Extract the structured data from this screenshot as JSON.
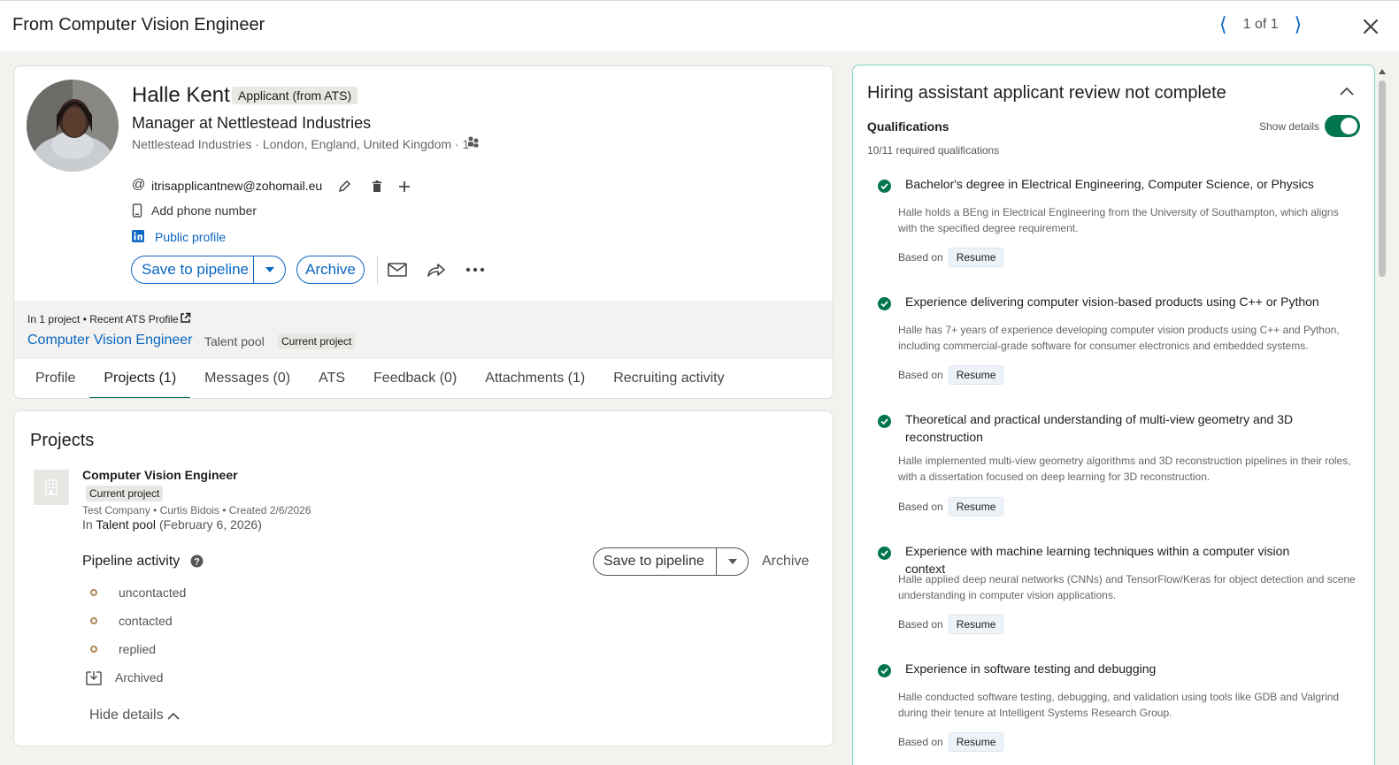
{
  "header": {
    "title": "From Computer Vision Engineer",
    "pager_text": "1 of 1"
  },
  "profile": {
    "name": "Halle Kent",
    "badge": "Applicant (from ATS)",
    "headline": "Manager at Nettlestead Industries",
    "meta": "Nettlestead Industries · London, England, United Kingdom · 1",
    "email": "itrisapplicantnew@zohomail.eu",
    "phone_label": "Add phone number",
    "public_profile_label": "Public profile",
    "save_label": "Save to pipeline",
    "archive_label": "Archive",
    "ats_line": "In 1 project • Recent ATS Profile",
    "project_link": "Computer Vision Engineer",
    "project_stage": "Talent pool",
    "project_tag": "Current project"
  },
  "tabs": [
    {
      "label": "Profile",
      "active": false
    },
    {
      "label": "Projects (1)",
      "active": true
    },
    {
      "label": "Messages (0)",
      "active": false
    },
    {
      "label": "ATS",
      "active": false
    },
    {
      "label": "Feedback (0)",
      "active": false
    },
    {
      "label": "Attachments (1)",
      "active": false
    },
    {
      "label": "Recruiting activity",
      "active": false
    }
  ],
  "projects": {
    "heading": "Projects",
    "item_title": "Computer Vision Engineer",
    "item_tag": "Current project",
    "item_meta": "Test Company • Curtis Bidois • Created 2/6/2026",
    "in_prefix": "In",
    "in_stage": "Talent pool",
    "in_date": "(February 6, 2026)",
    "pipeline_heading": "Pipeline activity",
    "save_label": "Save to pipeline",
    "archive_label": "Archive",
    "stages": [
      "uncontacted",
      "contacted",
      "replied"
    ],
    "archived_label": "Archived",
    "hide_details": "Hide details"
  },
  "hiring": {
    "title": "Hiring assistant applicant review not complete",
    "qual_heading": "Qualifications",
    "show_details": "Show details",
    "summary": "10/11 required qualifications",
    "based_on": "Based on",
    "items": [
      {
        "title": "Bachelor's degree in Electrical Engineering, Computer Science, or Physics",
        "desc": "Halle holds a BEng in Electrical Engineering from the University of Southampton, which aligns with the specified degree requirement.",
        "source": "Resume"
      },
      {
        "title": "Experience delivering computer vision-based products using C++ or Python",
        "desc": "Halle has 7+ years of experience developing computer vision products using C++ and Python, including commercial-grade software for consumer electronics and embedded systems.",
        "source": "Resume"
      },
      {
        "title": "Theoretical and practical understanding of multi-view geometry and 3D reconstruction",
        "desc": "Halle implemented multi-view geometry algorithms and 3D reconstruction pipelines in their roles, with a dissertation focused on deep learning for 3D reconstruction.",
        "source": "Resume"
      },
      {
        "title": "Experience with machine learning techniques within a computer vision context",
        "desc": "Halle applied deep neural networks (CNNs) and TensorFlow/Keras for object detection and scene understanding in computer vision applications.",
        "source": "Resume"
      },
      {
        "title": "Experience in software testing and debugging",
        "desc": "Halle conducted software testing, debugging, and validation using tools like GDB and Valgrind during their tenure at Intelligent Systems Research Group.",
        "source": "Resume"
      }
    ]
  },
  "colors": {
    "brand_blue": "#0a66c2",
    "green": "#01754f",
    "panel_border": "#7fd6cf"
  }
}
